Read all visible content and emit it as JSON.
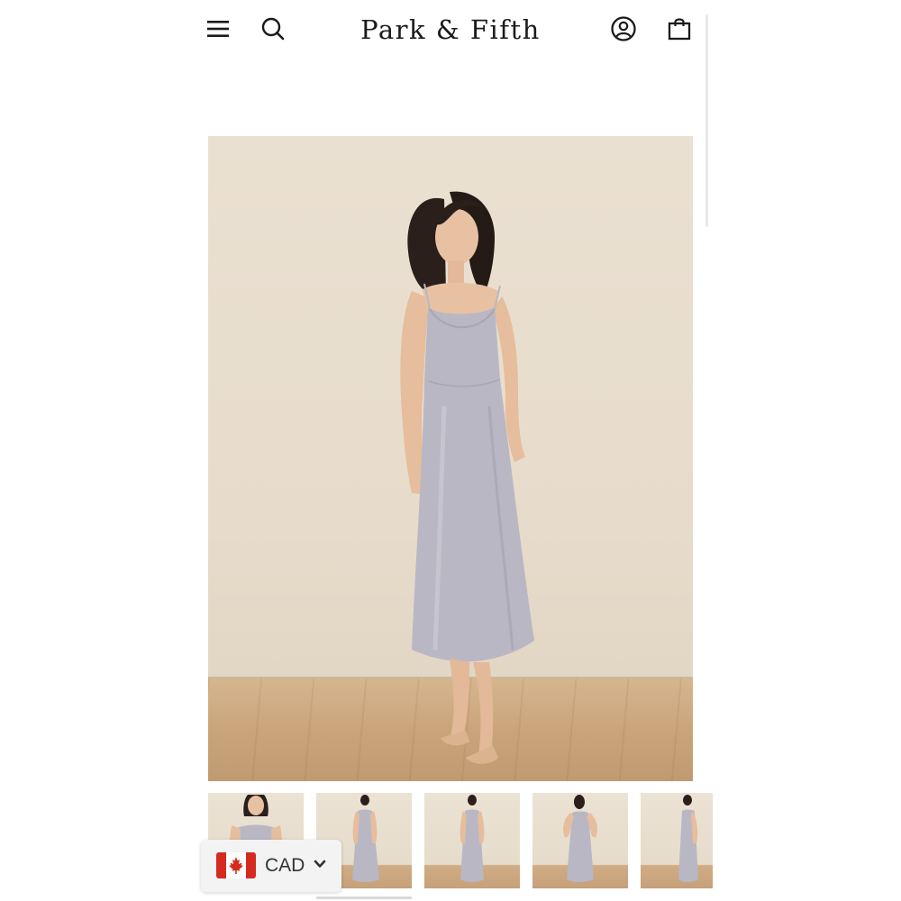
{
  "header": {
    "brand": "Park & Fifth",
    "icons": {
      "menu": "hamburger-menu-icon",
      "search": "search-icon",
      "account": "account-icon",
      "cart": "shopping-bag-icon"
    }
  },
  "gallery": {
    "thumbnails": [
      "front-closeup-thumbnail",
      "front-full-length-thumbnail",
      "front-straight-thumbnail",
      "back-view-thumbnail",
      "side-view-thumbnail"
    ]
  },
  "currency": {
    "code": "CAD",
    "flag": "canada-flag-icon"
  },
  "colors": {
    "dress": "#b8b6c2",
    "backdrop": "#e8ddcc",
    "floor": "#c9a47b",
    "flag_red": "#d52b1e"
  }
}
